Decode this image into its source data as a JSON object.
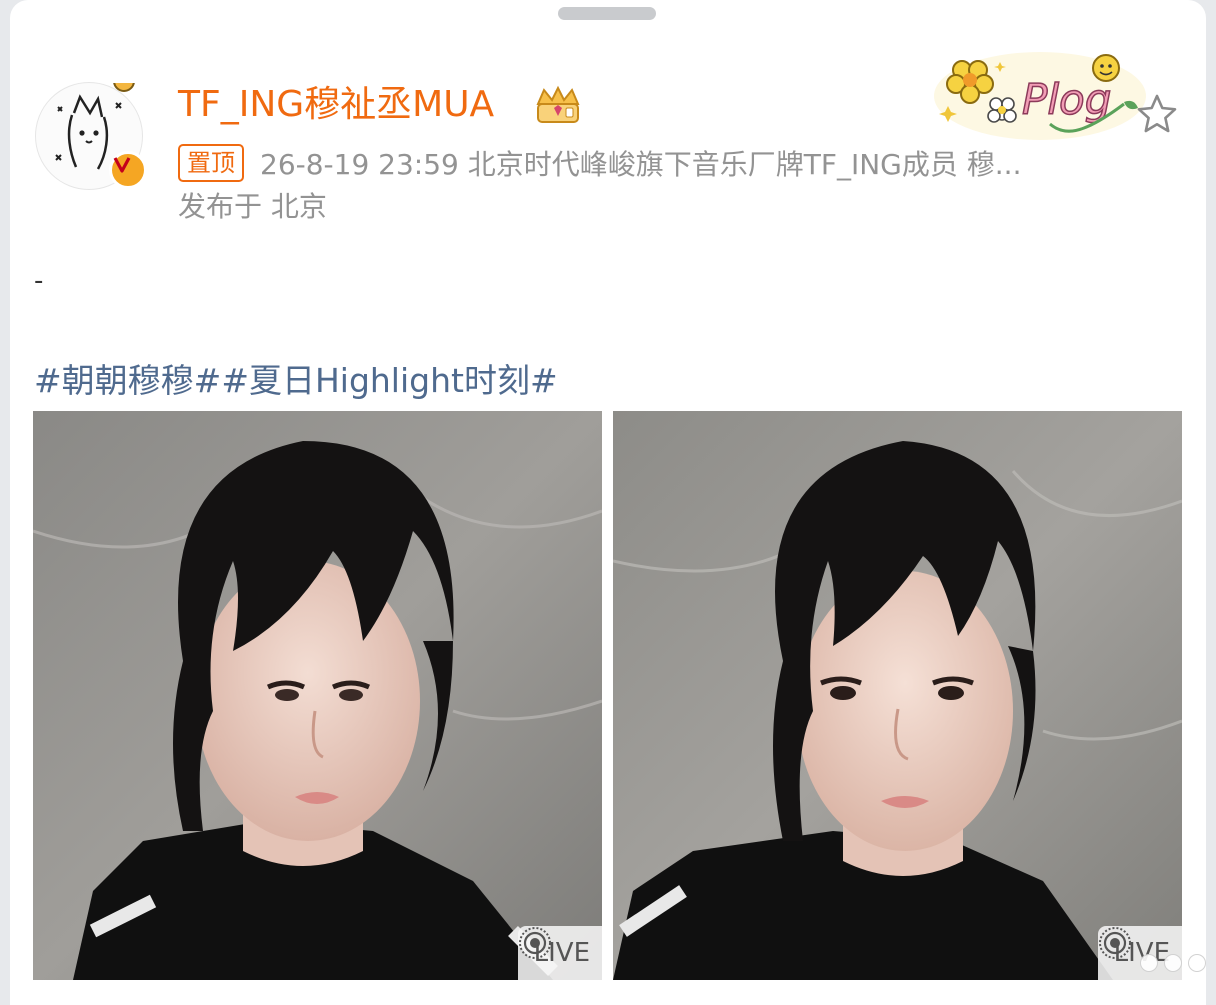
{
  "post": {
    "author": {
      "name": "TF_ING穆祉丞MUA",
      "avatar_icon": "doodle-cat-avatar",
      "badge_icon": "verified-v-icon",
      "vip_icon": "vip-crown-icon"
    },
    "pinned_label": "置顶",
    "meta": "26-8-19 23:59   北京时代峰峻旗下音乐厂牌TF_ING成员 穆...",
    "location": "发布于 北京",
    "sticker_text": "Plog",
    "text": "-",
    "hashtags": [
      "#朝朝穆穆#",
      "#夏日Highlight时刻#"
    ],
    "photos": [
      {
        "live_label": "LIVE"
      },
      {
        "live_label": "LIVE"
      }
    ]
  },
  "colors": {
    "accent": "#f06a10",
    "hashtag": "#4f6a8e",
    "meta_gray": "#939393"
  }
}
